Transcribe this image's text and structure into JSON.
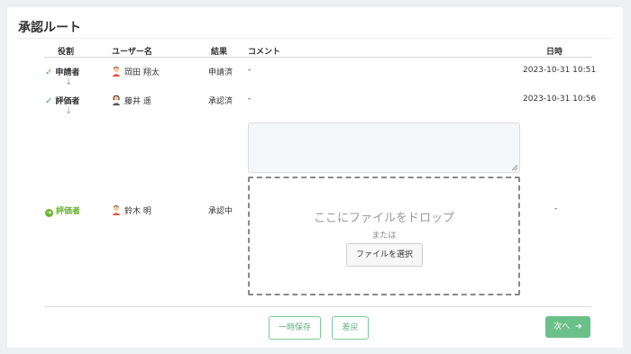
{
  "section_title": "承認ルート",
  "columns": {
    "role": "役割",
    "user": "ユーザー名",
    "result": "結果",
    "comment": "コメント",
    "datetime": "日時"
  },
  "rows": [
    {
      "role": "申請者",
      "user": "岡田 翔太",
      "result": "申請済",
      "comment": "-",
      "datetime": "2023-10-31 10:51",
      "status": "done"
    },
    {
      "role": "評価者",
      "user": "藤井 遥",
      "result": "承認済",
      "comment": "-",
      "datetime": "2023-10-31 10:56",
      "status": "done"
    },
    {
      "role": "評価者",
      "user": "鈴木 明",
      "result": "承認中",
      "comment": "",
      "datetime": "-",
      "status": "current"
    }
  ],
  "flow_arrow": "↓",
  "dropzone": {
    "main": "ここにファイルをドロップ",
    "or": "または",
    "select_button": "ファイルを選択"
  },
  "footer": {
    "save_temp": "一時保存",
    "send_back": "差戻",
    "next": "次へ"
  },
  "colors": {
    "accent_green": "#66b32e",
    "button_green": "#6cc08a"
  }
}
